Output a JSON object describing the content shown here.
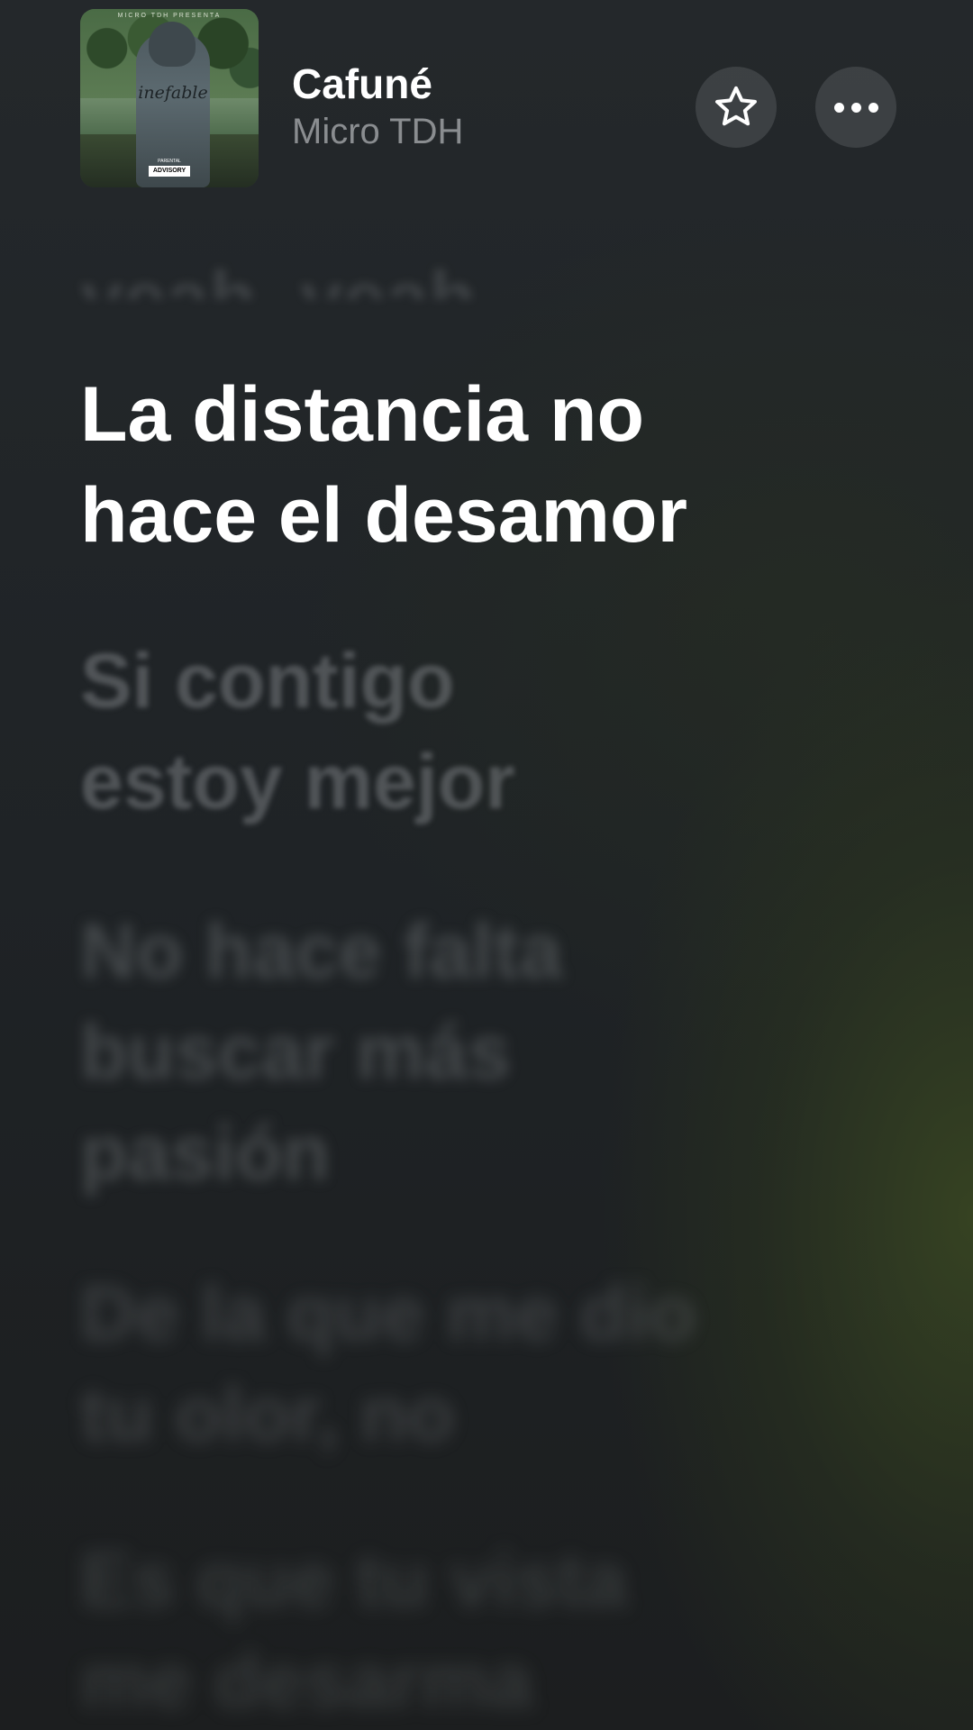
{
  "now_playing": {
    "title": "Cafuné",
    "artist": "Micro TDH",
    "album_art": {
      "top_text": "MICRO TDH PRESENTA",
      "script_text": "inefable",
      "parental_label": "PARENTAL",
      "advisory_label": "ADVISORY"
    }
  },
  "buttons": {
    "favorite_icon": "star-outline-icon",
    "more_icon": "ellipsis-icon"
  },
  "lyrics": {
    "previous": "yeah, yeah",
    "current": "La distancia no\nhace el desamor",
    "upcoming": [
      "Si contigo\nestoy mejor",
      "No hace falta\nbuscar más\npasión",
      "De la que me dio\ntu olor, no",
      "Es que tu vista\nme desarma"
    ]
  }
}
